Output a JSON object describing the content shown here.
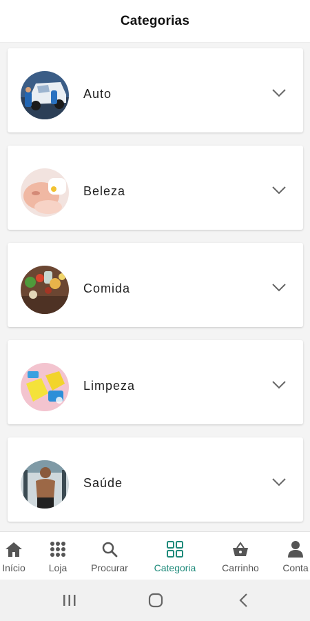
{
  "header": {
    "title": "Categorias"
  },
  "categories": [
    {
      "label": "Auto"
    },
    {
      "label": "Beleza"
    },
    {
      "label": "Comida"
    },
    {
      "label": "Limpeza"
    },
    {
      "label": "Saúde"
    }
  ],
  "bottom_nav": {
    "items": [
      {
        "label": "Início",
        "icon": "home-icon"
      },
      {
        "label": "Loja",
        "icon": "grid-dots-icon"
      },
      {
        "label": "Procurar",
        "icon": "search-icon"
      },
      {
        "label": "Categoria",
        "icon": "category-grid-icon",
        "active": true
      },
      {
        "label": "Carrinho",
        "icon": "basket-icon"
      },
      {
        "label": "Conta",
        "icon": "person-icon"
      }
    ],
    "active_color": "#1e8a7a"
  },
  "system_nav": {
    "buttons": [
      "recent-apps-icon",
      "home-circle-icon",
      "back-icon"
    ]
  }
}
